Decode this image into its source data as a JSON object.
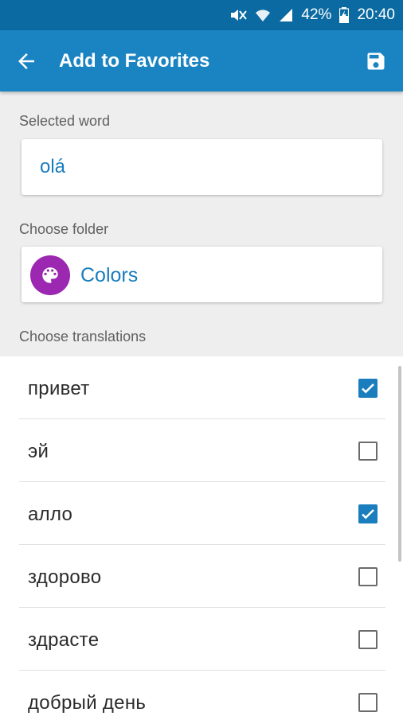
{
  "status_bar": {
    "battery_percent": "42%",
    "time": "20:40",
    "icons": [
      "mute-icon",
      "wifi-icon",
      "signal-icon",
      "battery-charging-icon"
    ]
  },
  "app_bar": {
    "title": "Add to Favorites",
    "back_icon": "arrow-back-icon",
    "save_icon": "save-icon"
  },
  "selected_word": {
    "label": "Selected word",
    "value": "olá"
  },
  "folder": {
    "label": "Choose folder",
    "name": "Colors",
    "icon": "palette-icon",
    "icon_color": "#9c27b0"
  },
  "translations": {
    "label": "Choose translations",
    "items": [
      {
        "label": "привет",
        "checked": true
      },
      {
        "label": "эй",
        "checked": false
      },
      {
        "label": "алло",
        "checked": true
      },
      {
        "label": "здорово",
        "checked": false
      },
      {
        "label": "здрасте",
        "checked": false
      },
      {
        "label": "добрый день",
        "checked": false
      }
    ]
  },
  "colors": {
    "status_bar": "#0a6aa1",
    "app_bar": "#1a84c3",
    "accent": "#1a7dbd"
  }
}
